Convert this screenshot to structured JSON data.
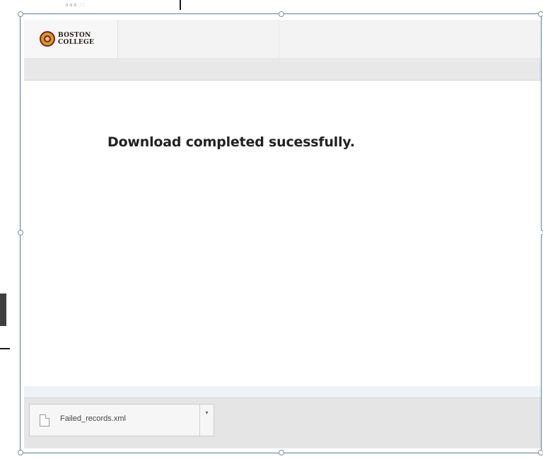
{
  "background": {
    "scrawl_text": "aaa:::"
  },
  "browser": {
    "logo": {
      "line1": "BOSTON",
      "line2": "COLLEGE"
    },
    "message": "Download completed sucessfully."
  },
  "download_shelf": {
    "item": {
      "filename": "Failed_records.xml",
      "dropdown_glyph": "▾"
    }
  },
  "colors": {
    "frame_border": "#5a7cae",
    "logo_red": "#8b1a1a",
    "logo_gold": "#c9a227"
  },
  "icons": [
    "file-icon",
    "chevron-down-icon",
    "boston-college-logo"
  ]
}
